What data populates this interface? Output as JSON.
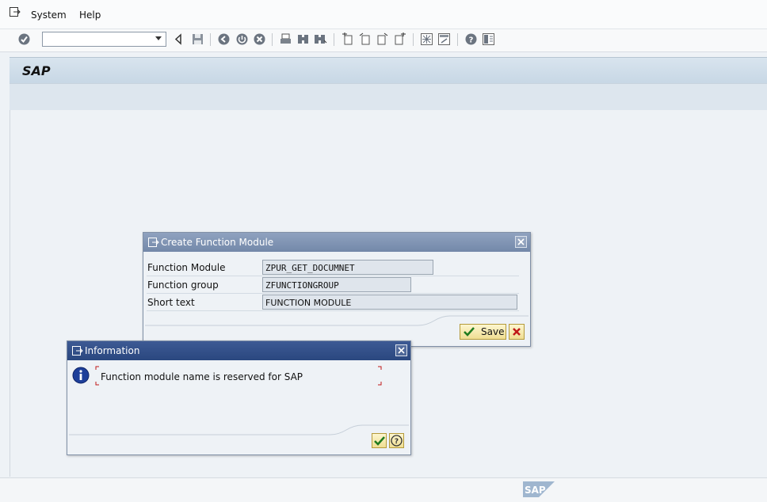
{
  "menu": {
    "items": [
      {
        "label": "System",
        "accel": "S",
        "rest": "ystem"
      },
      {
        "label": "Help",
        "accel": "H",
        "rest": "elp"
      }
    ]
  },
  "toolbar": {
    "command_field_value": ""
  },
  "screen": {
    "title": "SAP"
  },
  "create_dialog": {
    "title": "Create Function Module",
    "fields": [
      {
        "label": "Function Module",
        "value": "ZPUR_GET_DOCUMNET"
      },
      {
        "label": "Function group",
        "value": "ZFUNCTIONGROUP"
      },
      {
        "label": "Short text",
        "value": "FUNCTION MODULE"
      }
    ],
    "save_label": "Save"
  },
  "info_dialog": {
    "title": "Information",
    "message": "Function module name is reserved for SAP"
  },
  "footer": {
    "logo_text": "SAP"
  },
  "colors": {
    "accent_title": "#2a477f",
    "dialog_title": "#7388a9",
    "button_yellow": "#efde92"
  }
}
